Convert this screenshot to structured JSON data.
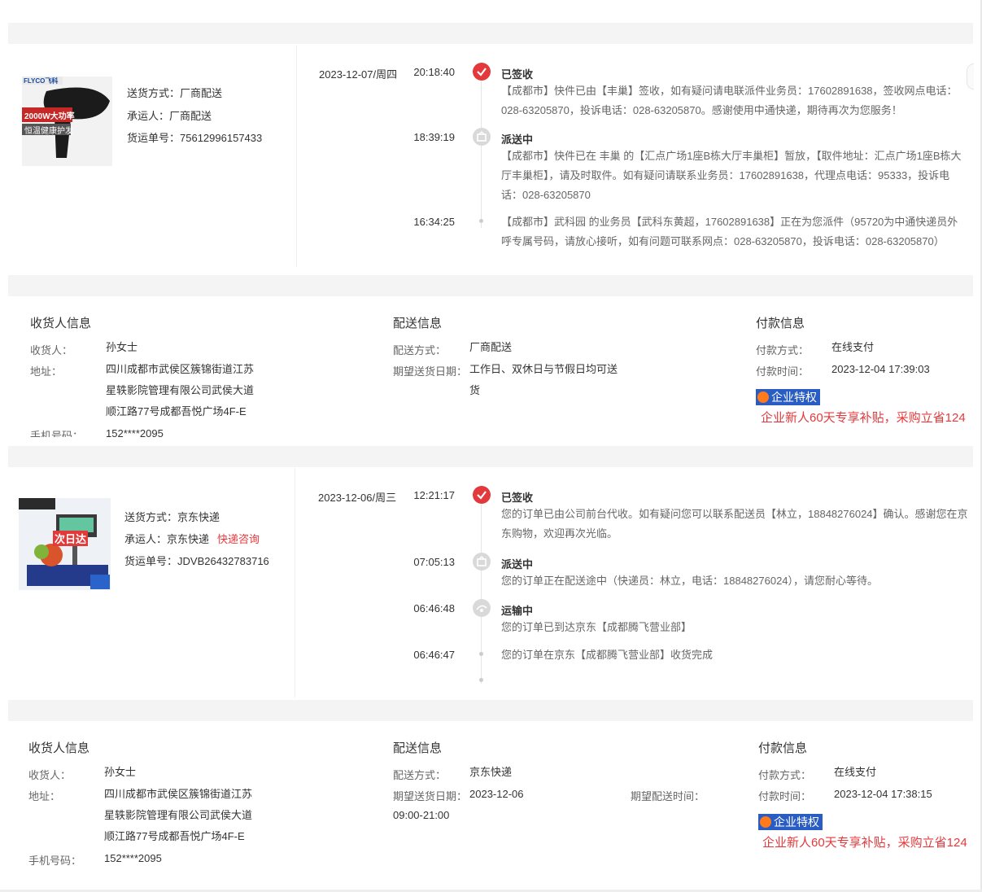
{
  "order1": {
    "shipping": {
      "method_label": "送货方式：",
      "method_value": "厂商配送",
      "carrier_label": "承运人：",
      "carrier_value": "厂商配送",
      "tracking_label": "货运单号：",
      "tracking_value": "75612996157433"
    },
    "product_image_text": {
      "brand": "FLYCO飞科",
      "power": "2000W大功率",
      "slogan": "恒温健康护发"
    },
    "timeline": {
      "date": "2023-12-07/周四",
      "events": [
        {
          "time": "20:18:40",
          "status": "已签收",
          "message": "【成都市】快件已由【丰巢】签收，如有疑问请电联派件业务员：17602891638，签收网点电话：028-63205870，投诉电话：028-63205870。感谢使用中通快递，期待再次为您服务！"
        },
        {
          "time": "18:39:19",
          "status": "派送中",
          "message": "【成都市】快件已在 丰巢 的【汇点广场1座B栋大厅丰巢柜】暂放，【取件地址：汇点广场1座B栋大厅丰巢柜】，请及时取件。如有疑问请联系业务员：17602891638，代理点电话：95333，投诉电话：028-63205870"
        },
        {
          "time": "16:34:25",
          "status": "",
          "message": "【成都市】武科园 的业务员【武科东黄超，17602891638】正在为您派件（95720为中通快递员外呼专属号码，请放心接听，如有问题可联系网点：028-63205870，投诉电话：028-63205870）"
        }
      ]
    },
    "receiver": {
      "title": "收货人信息",
      "name_label": "收货人：",
      "name_value": "孙女士",
      "address_label": "地址：",
      "address_value": "四川成都市武侯区簇锦街道江苏星轶影院管理有限公司武侯大道顺江路77号成都吾悦广场4F-E",
      "phone_label": "手机号码：",
      "phone_value": "152****2095"
    },
    "delivery": {
      "title": "配送信息",
      "method_label": "配送方式：",
      "method_value": "厂商配送",
      "expect_label": "期望送货日期：",
      "expect_value": "工作日、双休日与节假日均可送货"
    },
    "payment": {
      "title": "付款信息",
      "method_label": "付款方式：",
      "method_value": "在线支付",
      "time_label": "付款时间：",
      "time_value": "2023-12-04 17:39:03",
      "badge": "企业特权",
      "promo": "企业新人60天专享补贴，采购立省124"
    }
  },
  "order2": {
    "shipping": {
      "method_label": "送货方式：",
      "method_value": "京东快递",
      "carrier_label": "承运人：",
      "carrier_value": "京东快递",
      "consult_link": "快递咨询",
      "tracking_label": "货运单号：",
      "tracking_value": "JDVB26432783716"
    },
    "product_image_text": {
      "tag": "次日达"
    },
    "timeline": {
      "date": "2023-12-06/周三",
      "events": [
        {
          "time": "12:21:17",
          "status": "已签收",
          "message": "您的订单已由公司前台代收。如有疑问您可以联系配送员【林立，18848276024】确认。感谢您在京东购物，欢迎再次光临。"
        },
        {
          "time": "07:05:13",
          "status": "派送中",
          "message": "您的订单正在配送途中（快递员：林立，电话：18848276024），请您耐心等待。"
        },
        {
          "time": "06:46:48",
          "status": "运输中",
          "message": "您的订单已到达京东【成都腾飞营业部】"
        },
        {
          "time": "06:46:47",
          "status": "",
          "message": "您的订单在京东【成都腾飞营业部】收货完成"
        }
      ]
    },
    "receiver": {
      "title": "收货人信息",
      "name_label": "收货人：",
      "name_value": "孙女士",
      "address_label": "地址：",
      "address_value": "四川成都市武侯区簇锦街道江苏星轶影院管理有限公司武侯大道顺江路77号成都吾悦广场4F-E",
      "phone_label": "手机号码：",
      "phone_value": "152****2095"
    },
    "delivery": {
      "title": "配送信息",
      "method_label": "配送方式：",
      "method_value": "京东快递",
      "expect_label": "期望送货日期：",
      "expect_value": "2023-12-06 09:00-21:00",
      "expect_time_label": "期望配送时间："
    },
    "payment": {
      "title": "付款信息",
      "method_label": "付款方式：",
      "method_value": "在线支付",
      "time_label": "付款时间：",
      "time_value": "2023-12-04 17:38:15",
      "badge": "企业特权",
      "promo": "企业新人60天专享补贴，采购立省124"
    }
  }
}
